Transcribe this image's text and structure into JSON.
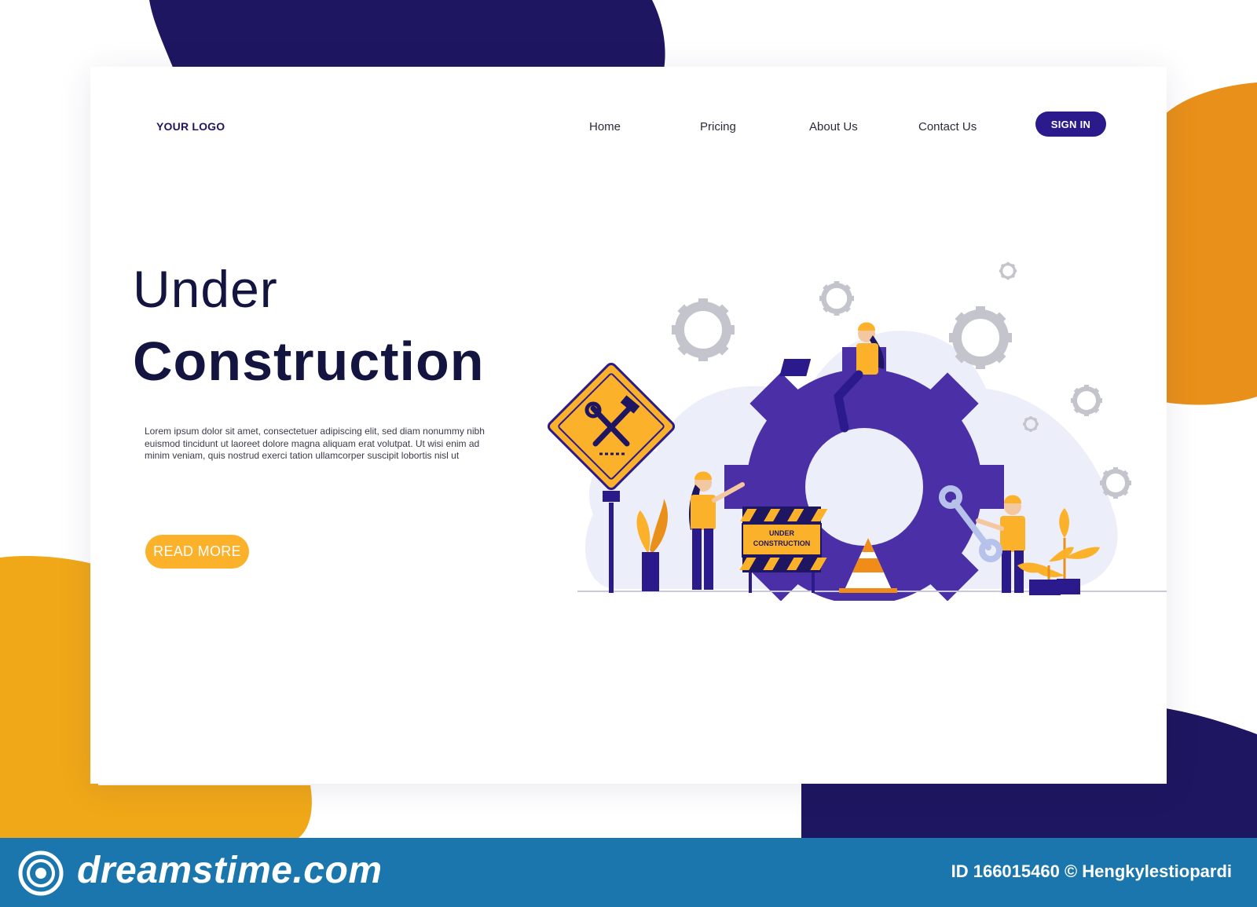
{
  "colors": {
    "navy": "#1e1660",
    "purple": "#4a2fa6",
    "accent_yellow": "#fbb12a",
    "orange": "#e8901a",
    "footer_blue": "#1a76ad",
    "gear_gray": "#c4c4cc"
  },
  "header": {
    "logo": "YOUR LOGO",
    "nav": [
      "Home",
      "Pricing",
      "About Us",
      "Contact Us"
    ],
    "signin_label": "SIGN IN"
  },
  "hero": {
    "title_line1": "Under",
    "title_line2": "Construction",
    "description": "Lorem ipsum dolor sit amet, consectetuer adipiscing elit, sed diam nonummy nibh euismod tincidunt ut laoreet dolore magna aliquam erat volutpat. Ut wisi enim ad minim veniam, quis nostrud exerci tation ullamcorper suscipit lobortis nisl ut",
    "cta_label": "READ MORE"
  },
  "illustration": {
    "barrier_line1": "UNDER",
    "barrier_line2": "CONSTRUCTION",
    "icons": [
      "gear-icon",
      "tools-sign-icon",
      "traffic-cone-icon",
      "wrench-icon",
      "plant-icon",
      "laptop-icon"
    ]
  },
  "footer": {
    "brand": "dreamstime.com",
    "image_id": "ID 166015460 © Hengkylestiopardi"
  }
}
